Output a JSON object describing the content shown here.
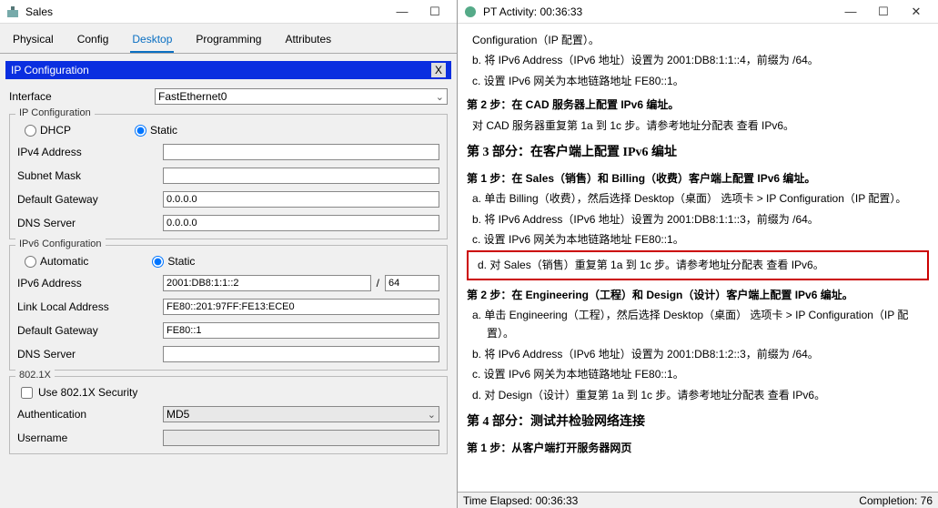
{
  "left": {
    "title": "Sales",
    "tabs": [
      "Physical",
      "Config",
      "Desktop",
      "Programming",
      "Attributes"
    ],
    "activeTab": 2,
    "panelTitle": "IP Configuration",
    "panelClose": "X",
    "iface": {
      "label": "Interface",
      "value": "FastEthernet0"
    },
    "ipcfg": {
      "legend": "IP Configuration",
      "dhcp": "DHCP",
      "static": "Static",
      "ipv4": {
        "label": "IPv4 Address",
        "value": ""
      },
      "mask": {
        "label": "Subnet Mask",
        "value": ""
      },
      "gw": {
        "label": "Default Gateway",
        "value": "0.0.0.0"
      },
      "dns": {
        "label": "DNS Server",
        "value": "0.0.0.0"
      }
    },
    "ipv6cfg": {
      "legend": "IPv6 Configuration",
      "auto": "Automatic",
      "static": "Static",
      "addr": {
        "label": "IPv6 Address",
        "value": "2001:DB8:1:1::2",
        "prefix": "64"
      },
      "ll": {
        "label": "Link Local Address",
        "value": "FE80::201:97FF:FE13:ECE0"
      },
      "gw": {
        "label": "Default Gateway",
        "value": "FE80::1"
      },
      "dns": {
        "label": "DNS Server",
        "value": ""
      }
    },
    "dot1x": {
      "legend": "802.1X",
      "use": "Use 802.1X Security",
      "auth": {
        "label": "Authentication",
        "value": "MD5"
      },
      "user": {
        "label": "Username",
        "value": ""
      }
    }
  },
  "right": {
    "title": "PT Activity: 00:36:33",
    "doc": {
      "l0": "Configuration（IP 配置）。",
      "l1": "b.  将 IPv6 Address（IPv6 地址）设置为 2001:DB8:1:1::4，前缀为 /64。",
      "l2": "c.  设置 IPv6 网关为本地链路地址 FE80::1。",
      "s2": "第 2 步：在 CAD 服务器上配置 IPv6 编址。",
      "s2a": "对 CAD 服务器重复第 1a 到 1c 步。请参考地址分配表 查看 IPv6。",
      "p3": "第 3 部分：在客户端上配置 IPv6 编址",
      "s31": "第 1 步：在 Sales（销售）和 Billing（收费）客户端上配置 IPv6 编址。",
      "s31a": "a.  单击 Billing（收费），然后选择 Desktop（桌面） 选项卡 > IP Configuration（IP 配置）。",
      "s31b": "b.  将 IPv6 Address（IPv6 地址）设置为 2001:DB8:1:1::3，前缀为 /64。",
      "s31c": "c.  设置 IPv6 网关为本地链路地址 FE80::1。",
      "s31d": "d.  对 Sales（销售）重复第 1a 到 1c 步。请参考地址分配表 查看 IPv6。",
      "s32": "第 2 步：在 Engineering（工程）和 Design（设计）客户端上配置 IPv6 编址。",
      "s32a": "a.  单击 Engineering（工程），然后选择 Desktop（桌面） 选项卡 > IP Configuration（IP 配置）。",
      "s32b": "b.  将 IPv6 Address（IPv6 地址）设置为 2001:DB8:1:2::3，前缀为 /64。",
      "s32c": "c.  设置 IPv6 网关为本地链路地址 FE80::1。",
      "s32d": "d.  对 Design（设计）重复第 1a 到 1c 步。请参考地址分配表 查看 IPv6。",
      "p4": "第 4 部分：测试并检验网络连接",
      "s41": "第 1 步：从客户端打开服务器网页"
    },
    "status": {
      "elapsed": "Time Elapsed: 00:36:33",
      "completion": "Completion: 76"
    }
  }
}
